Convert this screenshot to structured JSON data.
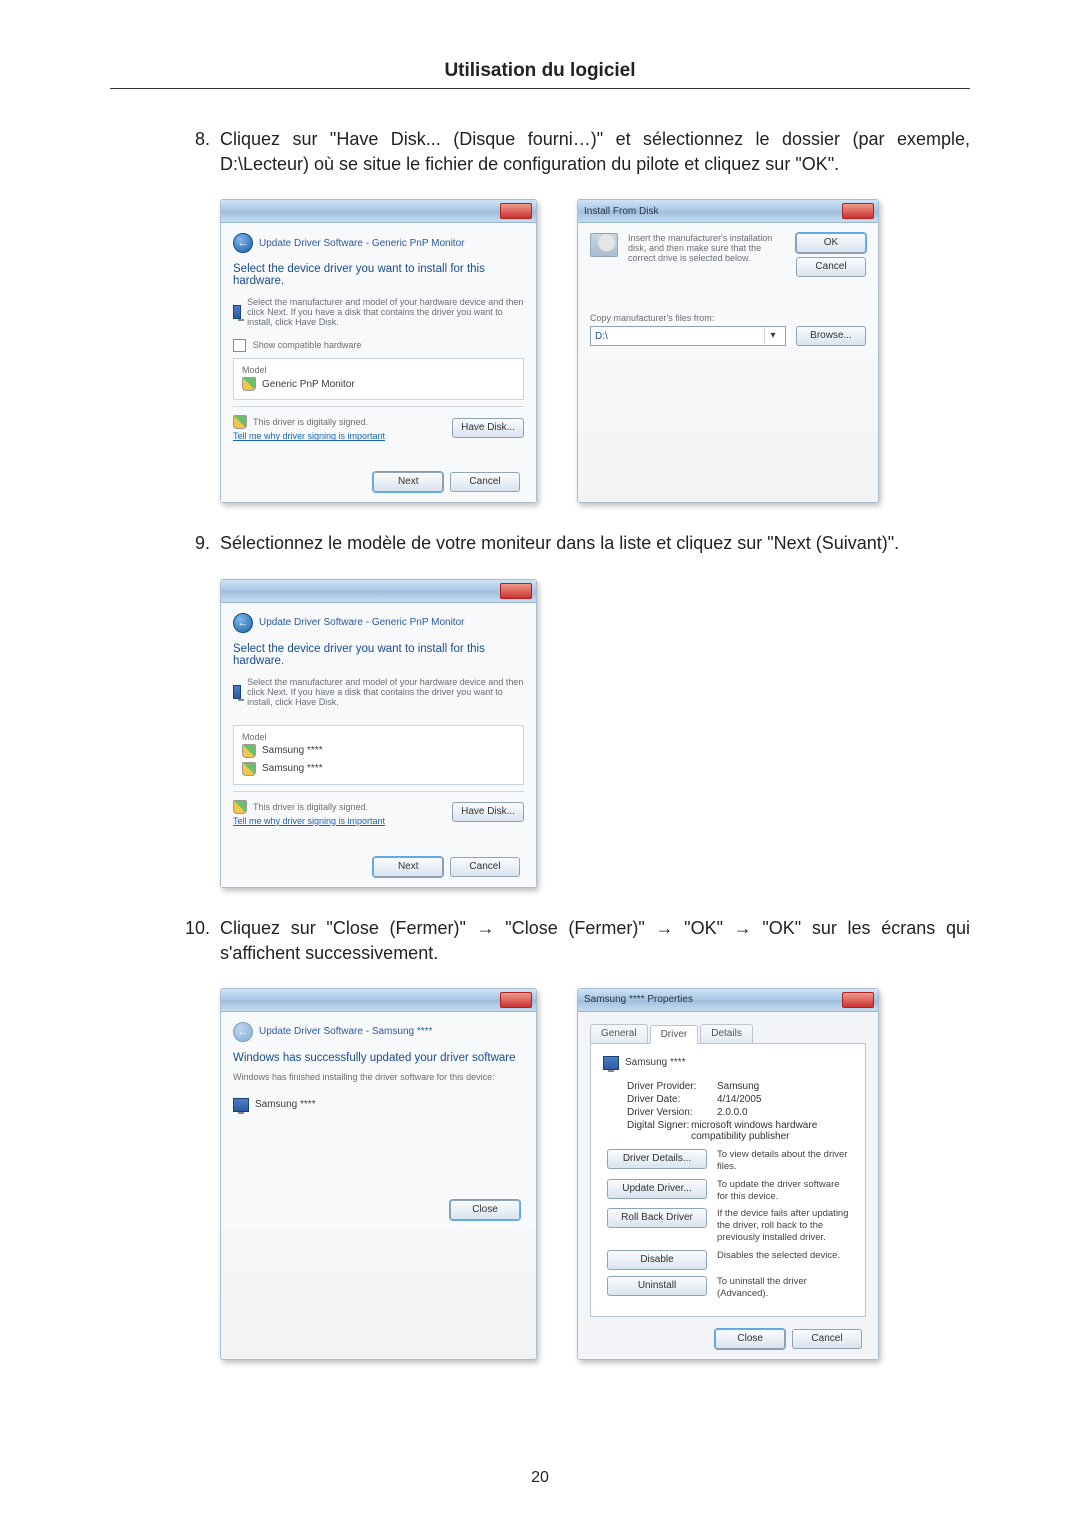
{
  "doc": {
    "title": "Utilisation du logiciel",
    "page_number": "20"
  },
  "steps": {
    "s8": {
      "num": "8.",
      "text": "Cliquez sur \"Have Disk... (Disque fourni…)\" et sélectionnez le dossier (par exemple, D:\\Lecteur) où se situe le fichier de configuration du pilote et cliquez sur \"OK\"."
    },
    "s9": {
      "num": "9.",
      "text": "Sélectionnez le modèle de votre moniteur dans la liste et cliquez sur \"Next (Suivant)\"."
    },
    "s10": {
      "num": "10.",
      "text": "Cliquez sur \"Close (Fermer)\" → \"Close (Fermer)\" → \"OK\" → \"OK\" sur les écrans qui s'affichent successivement."
    }
  },
  "d2": {
    "crumb": "Update Driver Software - Generic PnP Monitor",
    "heading": "Select the device driver you want to install for this hardware.",
    "hint": "Select the manufacturer and model of your hardware device and then click Next. If you have a disk that contains the driver you want to install, click Have Disk.",
    "chk": "Show compatible hardware",
    "model_label": "Model",
    "model_item": "Generic PnP Monitor",
    "signed": "This driver is digitally signed.",
    "signed_link": "Tell me why driver signing is important",
    "have_disk": "Have Disk...",
    "next": "Next",
    "cancel": "Cancel"
  },
  "ifd": {
    "title": "Install From Disk",
    "msg": "Insert the manufacturer's installation disk, and then make sure that the correct drive is selected below.",
    "ok": "OK",
    "cancel": "Cancel",
    "copy_label": "Copy manufacturer's files from:",
    "path": "D:\\",
    "browse": "Browse..."
  },
  "d3": {
    "crumb": "Update Driver Software - Generic PnP Monitor",
    "heading": "Select the device driver you want to install for this hardware.",
    "hint": "Select the manufacturer and model of your hardware device and then click Next. If you have a disk that contains the driver you want to install, click Have Disk.",
    "model_label": "Model",
    "model_item1": "Samsung ****",
    "model_item2": "Samsung ****",
    "signed": "This driver is digitally signed.",
    "signed_link": "Tell me why driver signing is important",
    "have_disk": "Have Disk...",
    "next": "Next",
    "cancel": "Cancel"
  },
  "d4": {
    "crumb": "Update Driver Software - Samsung ****",
    "heading": "Windows has successfully updated your driver software",
    "sub": "Windows has finished installing the driver software for this device:",
    "device": "Samsung ****",
    "close": "Close"
  },
  "prop": {
    "title": "Samsung **** Properties",
    "tab_general": "General",
    "tab_driver": "Driver",
    "tab_details": "Details",
    "device": "Samsung ****",
    "provider_k": "Driver Provider:",
    "provider_v": "Samsung",
    "date_k": "Driver Date:",
    "date_v": "4/14/2005",
    "version_k": "Driver Version:",
    "version_v": "2.0.0.0",
    "signer_k": "Digital Signer:",
    "signer_v": "microsoft windows hardware compatibility publisher",
    "btn_details": "Driver Details...",
    "btn_details_d": "To view details about the driver files.",
    "btn_update": "Update Driver...",
    "btn_update_d": "To update the driver software for this device.",
    "btn_rollback": "Roll Back Driver",
    "btn_rollback_d": "If the device fails after updating the driver, roll back to the previously installed driver.",
    "btn_disable": "Disable",
    "btn_disable_d": "Disables the selected device.",
    "btn_uninstall": "Uninstall",
    "btn_uninstall_d": "To uninstall the driver (Advanced).",
    "close": "Close",
    "cancel": "Cancel"
  }
}
